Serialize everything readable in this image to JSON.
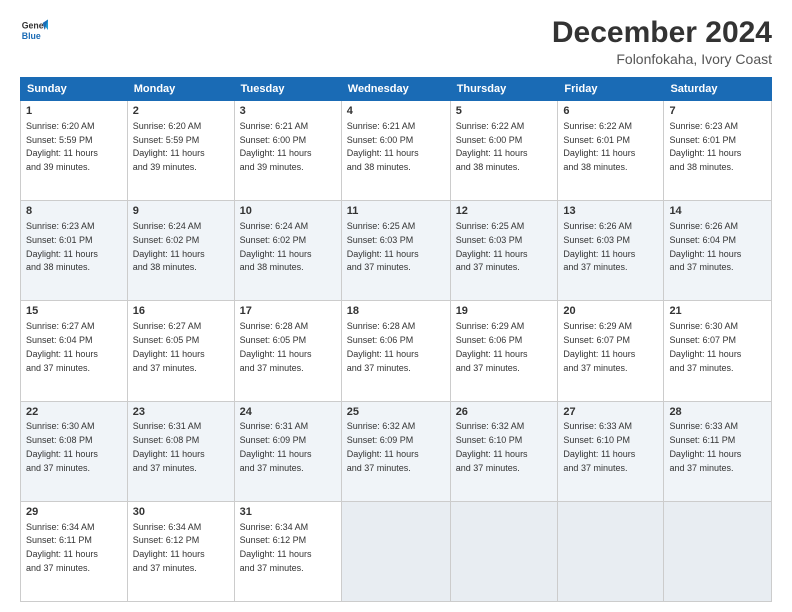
{
  "logo": {
    "line1": "General",
    "line2": "Blue"
  },
  "title": "December 2024",
  "subtitle": "Folonfokaha, Ivory Coast",
  "header_days": [
    "Sunday",
    "Monday",
    "Tuesday",
    "Wednesday",
    "Thursday",
    "Friday",
    "Saturday"
  ],
  "weeks": [
    [
      {
        "day": 1,
        "info": "Sunrise: 6:20 AM\nSunset: 5:59 PM\nDaylight: 11 hours\nand 39 minutes."
      },
      {
        "day": 2,
        "info": "Sunrise: 6:20 AM\nSunset: 5:59 PM\nDaylight: 11 hours\nand 39 minutes."
      },
      {
        "day": 3,
        "info": "Sunrise: 6:21 AM\nSunset: 6:00 PM\nDaylight: 11 hours\nand 39 minutes."
      },
      {
        "day": 4,
        "info": "Sunrise: 6:21 AM\nSunset: 6:00 PM\nDaylight: 11 hours\nand 38 minutes."
      },
      {
        "day": 5,
        "info": "Sunrise: 6:22 AM\nSunset: 6:00 PM\nDaylight: 11 hours\nand 38 minutes."
      },
      {
        "day": 6,
        "info": "Sunrise: 6:22 AM\nSunset: 6:01 PM\nDaylight: 11 hours\nand 38 minutes."
      },
      {
        "day": 7,
        "info": "Sunrise: 6:23 AM\nSunset: 6:01 PM\nDaylight: 11 hours\nand 38 minutes."
      }
    ],
    [
      {
        "day": 8,
        "info": "Sunrise: 6:23 AM\nSunset: 6:01 PM\nDaylight: 11 hours\nand 38 minutes."
      },
      {
        "day": 9,
        "info": "Sunrise: 6:24 AM\nSunset: 6:02 PM\nDaylight: 11 hours\nand 38 minutes."
      },
      {
        "day": 10,
        "info": "Sunrise: 6:24 AM\nSunset: 6:02 PM\nDaylight: 11 hours\nand 38 minutes."
      },
      {
        "day": 11,
        "info": "Sunrise: 6:25 AM\nSunset: 6:03 PM\nDaylight: 11 hours\nand 37 minutes."
      },
      {
        "day": 12,
        "info": "Sunrise: 6:25 AM\nSunset: 6:03 PM\nDaylight: 11 hours\nand 37 minutes."
      },
      {
        "day": 13,
        "info": "Sunrise: 6:26 AM\nSunset: 6:03 PM\nDaylight: 11 hours\nand 37 minutes."
      },
      {
        "day": 14,
        "info": "Sunrise: 6:26 AM\nSunset: 6:04 PM\nDaylight: 11 hours\nand 37 minutes."
      }
    ],
    [
      {
        "day": 15,
        "info": "Sunrise: 6:27 AM\nSunset: 6:04 PM\nDaylight: 11 hours\nand 37 minutes."
      },
      {
        "day": 16,
        "info": "Sunrise: 6:27 AM\nSunset: 6:05 PM\nDaylight: 11 hours\nand 37 minutes."
      },
      {
        "day": 17,
        "info": "Sunrise: 6:28 AM\nSunset: 6:05 PM\nDaylight: 11 hours\nand 37 minutes."
      },
      {
        "day": 18,
        "info": "Sunrise: 6:28 AM\nSunset: 6:06 PM\nDaylight: 11 hours\nand 37 minutes."
      },
      {
        "day": 19,
        "info": "Sunrise: 6:29 AM\nSunset: 6:06 PM\nDaylight: 11 hours\nand 37 minutes."
      },
      {
        "day": 20,
        "info": "Sunrise: 6:29 AM\nSunset: 6:07 PM\nDaylight: 11 hours\nand 37 minutes."
      },
      {
        "day": 21,
        "info": "Sunrise: 6:30 AM\nSunset: 6:07 PM\nDaylight: 11 hours\nand 37 minutes."
      }
    ],
    [
      {
        "day": 22,
        "info": "Sunrise: 6:30 AM\nSunset: 6:08 PM\nDaylight: 11 hours\nand 37 minutes."
      },
      {
        "day": 23,
        "info": "Sunrise: 6:31 AM\nSunset: 6:08 PM\nDaylight: 11 hours\nand 37 minutes."
      },
      {
        "day": 24,
        "info": "Sunrise: 6:31 AM\nSunset: 6:09 PM\nDaylight: 11 hours\nand 37 minutes."
      },
      {
        "day": 25,
        "info": "Sunrise: 6:32 AM\nSunset: 6:09 PM\nDaylight: 11 hours\nand 37 minutes."
      },
      {
        "day": 26,
        "info": "Sunrise: 6:32 AM\nSunset: 6:10 PM\nDaylight: 11 hours\nand 37 minutes."
      },
      {
        "day": 27,
        "info": "Sunrise: 6:33 AM\nSunset: 6:10 PM\nDaylight: 11 hours\nand 37 minutes."
      },
      {
        "day": 28,
        "info": "Sunrise: 6:33 AM\nSunset: 6:11 PM\nDaylight: 11 hours\nand 37 minutes."
      }
    ],
    [
      {
        "day": 29,
        "info": "Sunrise: 6:34 AM\nSunset: 6:11 PM\nDaylight: 11 hours\nand 37 minutes."
      },
      {
        "day": 30,
        "info": "Sunrise: 6:34 AM\nSunset: 6:12 PM\nDaylight: 11 hours\nand 37 minutes."
      },
      {
        "day": 31,
        "info": "Sunrise: 6:34 AM\nSunset: 6:12 PM\nDaylight: 11 hours\nand 37 minutes."
      },
      null,
      null,
      null,
      null
    ]
  ]
}
